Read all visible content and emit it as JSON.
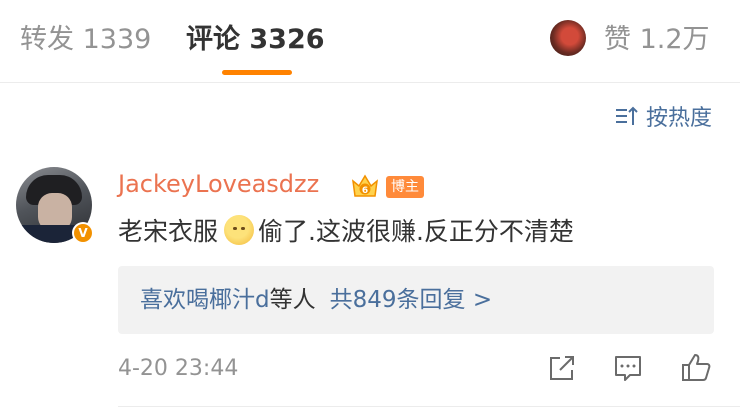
{
  "tabs": {
    "repost": "转发 1339",
    "comments": "评论 3326",
    "likes": "赞 1.2万"
  },
  "sort": {
    "label": "按热度"
  },
  "comment": {
    "username": "JackeyLoveasdzz",
    "badge": "博主",
    "crown_level": "6",
    "verified_mark": "V",
    "text_before": "老宋衣服",
    "text_after": "偷了.这波很赚.反正分不清楚",
    "emoji": "smile-emoji",
    "replies": {
      "names": "喜欢喝椰汁d",
      "etc": "等人",
      "count": "共849条回复 >"
    },
    "timestamp": "4-20 23:44"
  },
  "colors": {
    "accent": "#ff8200",
    "username": "#eb7350",
    "link": "#4a6f9c",
    "muted": "#939393",
    "text": "#333333"
  }
}
